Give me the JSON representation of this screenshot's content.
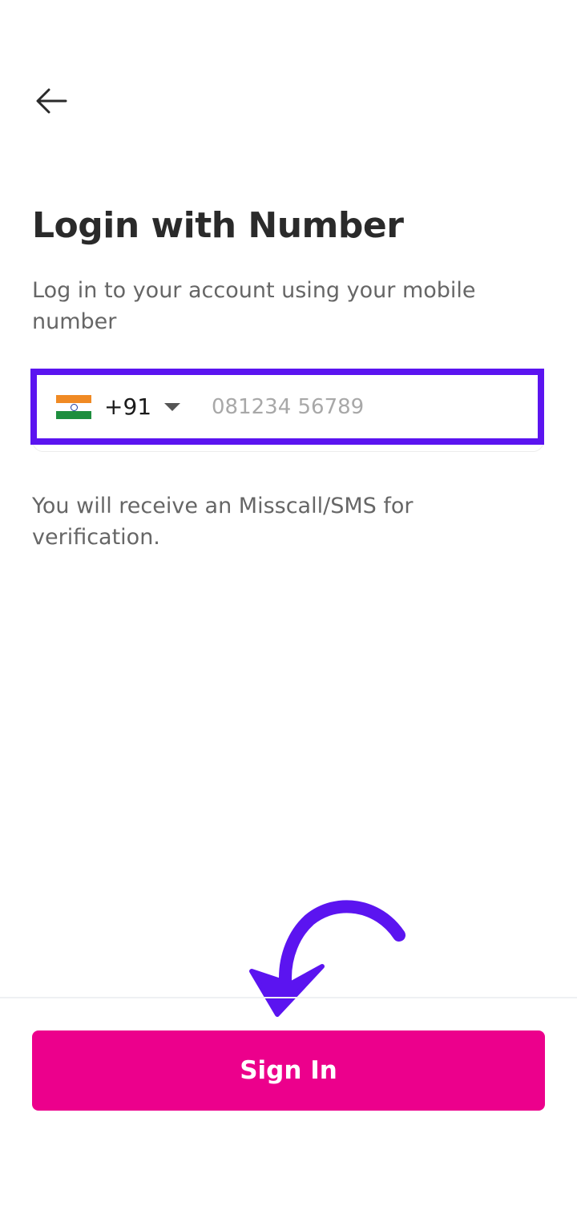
{
  "header": {
    "back_icon": "arrow-left-icon"
  },
  "title": "Login with Number",
  "subtitle": "Log in to your account using your mobile number",
  "phone": {
    "country_flag": "india-flag-icon",
    "dial_code": "+91",
    "caret_icon": "caret-down-icon",
    "value": "",
    "placeholder": "081234 56789"
  },
  "note": "You will receive an Misscall/SMS for verification.",
  "annotation_icon": "curved-arrow-icon",
  "footer": {
    "signin_label": "Sign In"
  },
  "colors": {
    "primary": "#ec008c",
    "highlight": "#5b14f0",
    "title": "#2a2a2a",
    "body_text": "#666666",
    "placeholder": "#a8a8a8"
  }
}
